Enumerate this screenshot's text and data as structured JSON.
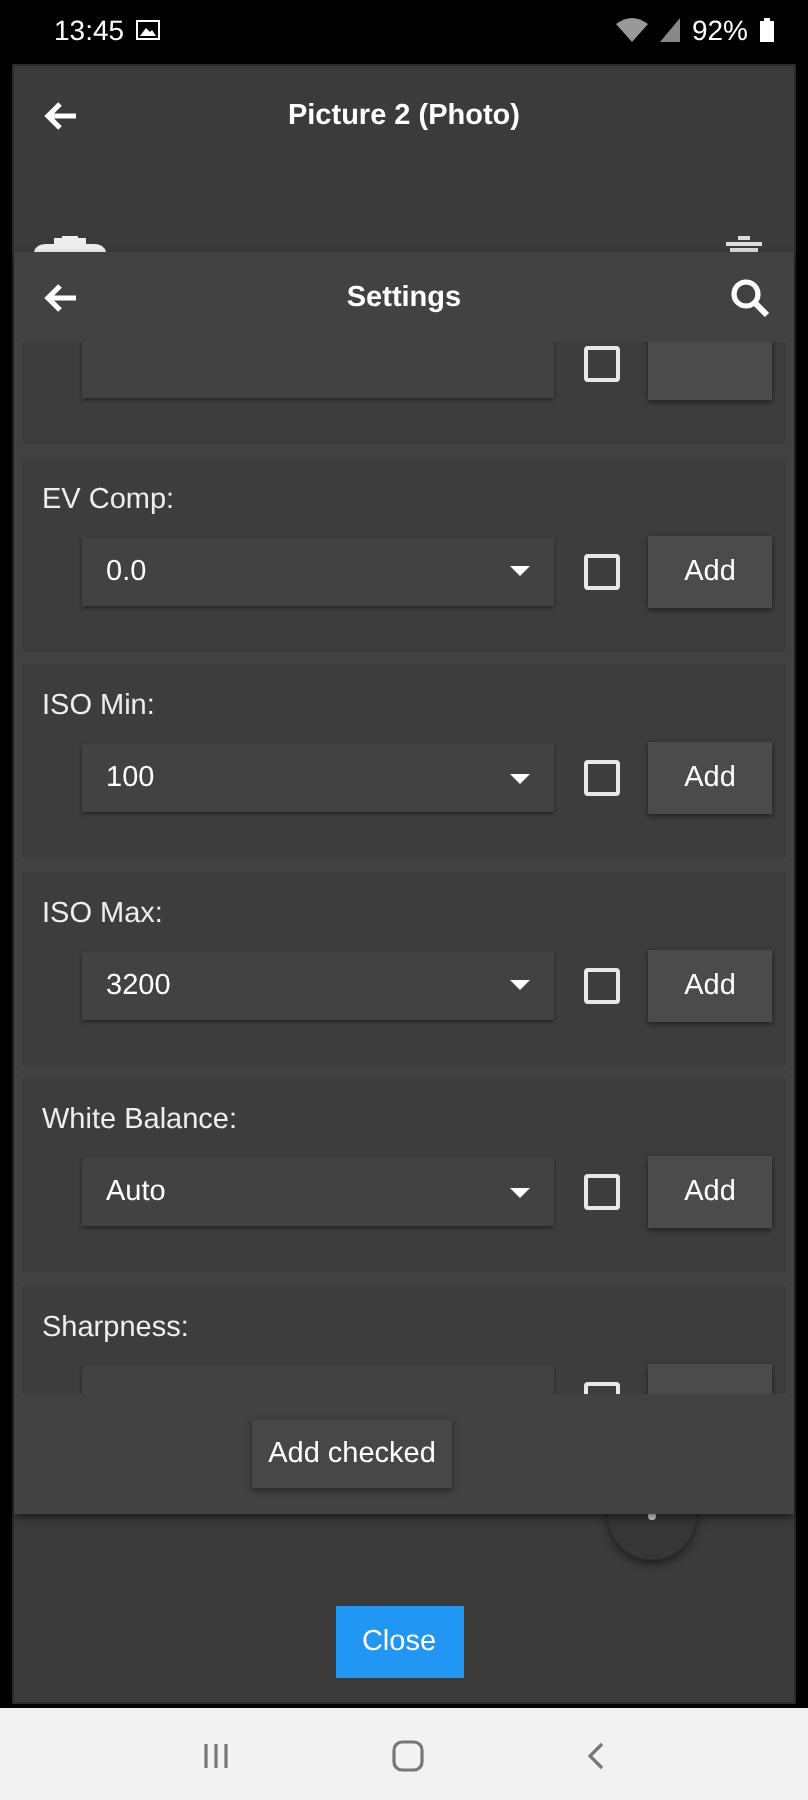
{
  "status_bar": {
    "time": "13:45",
    "battery": "92%"
  },
  "dialog": {
    "title": "Picture 2 (Photo)"
  },
  "settings": {
    "title": "Settings",
    "items": [
      {
        "checked": false
      },
      {
        "label": "EV Comp:",
        "value": "0.0",
        "checked": false,
        "button": "Add"
      },
      {
        "label": "ISO Min:",
        "value": "100",
        "checked": false,
        "button": "Add"
      },
      {
        "label": "ISO Max:",
        "value": "3200",
        "checked": false,
        "button": "Add"
      },
      {
        "label": "White Balance:",
        "value": "Auto",
        "checked": false,
        "button": "Add"
      },
      {
        "label": "Sharpness:",
        "checked": false
      }
    ],
    "add_checked": "Add checked"
  },
  "close_button": "Close"
}
